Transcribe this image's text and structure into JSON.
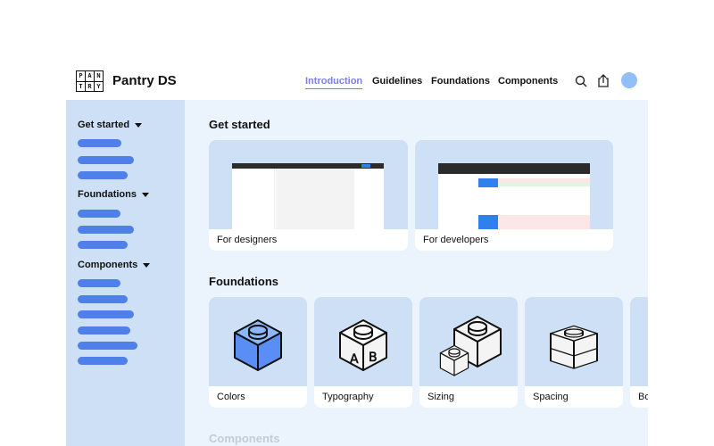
{
  "header": {
    "logo_letters": [
      "P",
      "A",
      "N",
      "T",
      "R",
      "Y"
    ],
    "brand": "Pantry DS",
    "nav": [
      "Introduction",
      "Guidelines",
      "Foundations",
      "Components"
    ],
    "active_nav": "Introduction",
    "icons": [
      "search-icon",
      "share-icon",
      "avatar"
    ],
    "avatar_color": "#93bff8"
  },
  "sidebar": {
    "sections": [
      {
        "label": "Get started"
      },
      {
        "label": "Foundations"
      },
      {
        "label": "Components"
      }
    ],
    "bar_color": "#4f7fe8"
  },
  "main": {
    "get_started": {
      "title": "Get started",
      "cards": [
        {
          "label": "For designers"
        },
        {
          "label": "For developers"
        }
      ]
    },
    "foundations": {
      "title": "Foundations",
      "cards": [
        {
          "label": "Colors"
        },
        {
          "label": "Typography"
        },
        {
          "label": "Sizing"
        },
        {
          "label": "Spacing"
        },
        {
          "label": "Bo"
        }
      ]
    },
    "components": {
      "title": "Components"
    }
  },
  "colors": {
    "accent": "#7b7fe8",
    "sidebar_bg": "#cde0f6",
    "main_bg": "#ebf3fc",
    "cube_blue": "#5b8ef5"
  }
}
